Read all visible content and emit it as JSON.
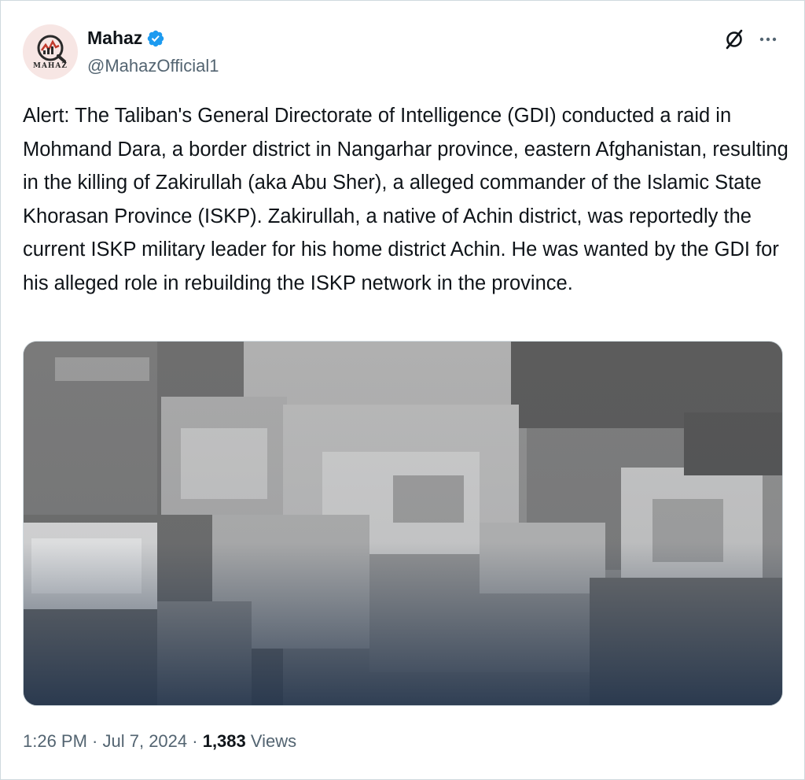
{
  "author": {
    "display_name": "Mahaz",
    "handle": "@MahazOfficial1",
    "avatar_text": "MAHAZ",
    "verified": true,
    "verified_color": "#1d9bf0"
  },
  "tweet": {
    "text": "Alert: The Taliban's General Directorate of Intelligence (GDI) conducted a raid in Mohmand Dara, a border district in Nangarhar province, eastern Afghanistan, resulting in the killing of Zakirullah (aka Abu Sher), a alleged commander of the Islamic State Khorasan Province (ISKP). Zakirullah, a native of Achin district, was reportedly the current ISKP military leader for his home district Achin. He was wanted by the GDI for his alleged role in rebuilding the ISKP network in the province."
  },
  "meta": {
    "time": "1:26 PM",
    "separator": " · ",
    "date": "Jul 7, 2024",
    "views_count": "1,383",
    "views_label": " Views"
  },
  "icons": {
    "grok": "grok-icon",
    "more": "more-icon",
    "verified": "verified-badge-icon"
  },
  "colors": {
    "text_primary": "#0f1419",
    "text_secondary": "#536471",
    "border": "#cfd9de"
  }
}
